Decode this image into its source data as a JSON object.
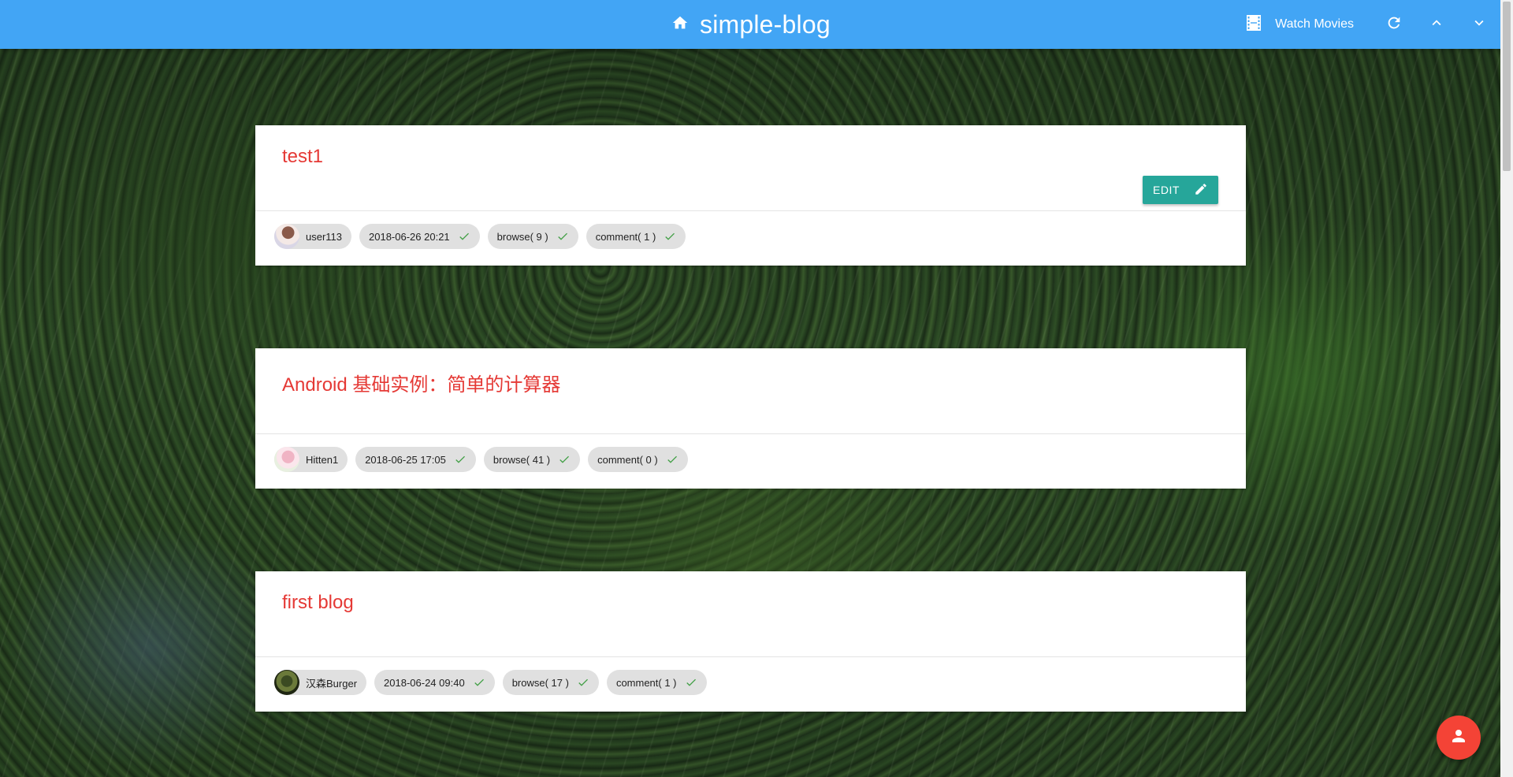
{
  "header": {
    "brand_title": "simple-blog",
    "movies_label": "Watch Movies",
    "bar_color": "#42a5f5"
  },
  "posts": [
    {
      "title": "test1",
      "author": "user113",
      "date": "2018-06-26 20:21",
      "browse": "browse( 9 )",
      "comment": "comment( 1 )",
      "edit_label": "EDIT"
    },
    {
      "title": "Android 基础实例：简单的计算器",
      "author": "Hitten1",
      "date": "2018-06-25 17:05",
      "browse": "browse( 41 )",
      "comment": "comment( 0 )"
    },
    {
      "title": "first blog",
      "author": "汉森Burger",
      "date": "2018-06-24 09:40",
      "browse": "browse( 17 )",
      "comment": "comment( 1 )"
    }
  ],
  "icons": {
    "home": "home-icon",
    "movies": "film-icon",
    "refresh": "refresh-icon",
    "up": "chevron-up-icon",
    "down": "chevron-down-icon",
    "edit": "pencil-icon",
    "check": "check-icon",
    "fab": "person-icon"
  },
  "colors": {
    "title_red": "#e53935",
    "edit_teal": "#26a69a",
    "fab_red": "#f44336",
    "check_green": "#43a047"
  }
}
